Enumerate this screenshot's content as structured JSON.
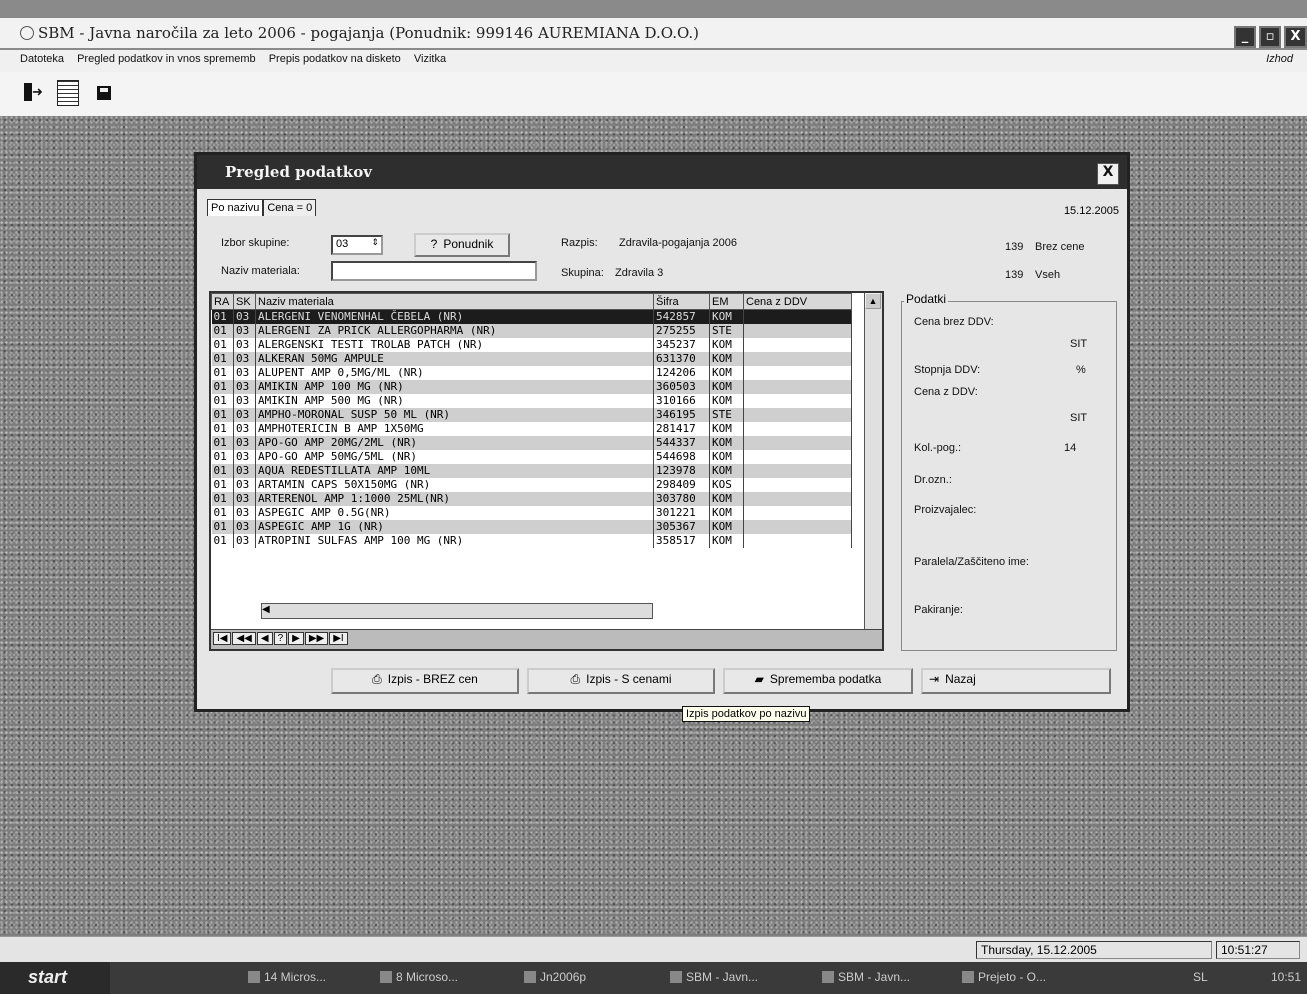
{
  "app": {
    "title": "SBM - Javna naročila za leto 2006 - pogajanja (Ponudnik: 999146 AUREMIANA D.O.O.)",
    "window_controls": [
      "_",
      "▫",
      "X"
    ]
  },
  "menu": {
    "items": [
      "Datoteka",
      "Pregled podatkov in vnos sprememb",
      "Prepis podatkov na disketo",
      "Vizitka"
    ],
    "exit_label": "Izhod"
  },
  "toolbar": {
    "icons": [
      "exit-door-icon",
      "document-icon",
      "floppy-icon"
    ]
  },
  "dialog": {
    "title": "Pregled podatkov",
    "close_label": "X",
    "tabs": [
      "Po nazivu",
      "Cena = 0"
    ],
    "date": "15.12.2005",
    "izbor_label": "Izbor skupine:",
    "izbor_value": "03",
    "ponudnik_button": "Ponudnik",
    "naziv_label": "Naziv materiala:",
    "naziv_value": "",
    "razpis_label": "Razpis:",
    "razpis_value": "Zdravila-pogajanja 2006",
    "skupina_label": "Skupina:",
    "skupina_value": "Zdravila 3",
    "count_brez_value": "139",
    "count_brez_label": "Brez cene",
    "count_vseh_value": "139",
    "count_vseh_label": "Vseh"
  },
  "grid": {
    "columns": [
      "RA",
      "SK",
      "Naziv materiala",
      "Šifra",
      "EM",
      "Cena z DDV"
    ],
    "rows": [
      [
        "01",
        "03",
        "ALERGENI VENOMENHAL ČEBELA (NR)",
        "542857",
        "KOM",
        ""
      ],
      [
        "01",
        "03",
        "ALERGENI ZA PRICK ALLERGOPHARMA (NR)",
        "275255",
        "STE",
        ""
      ],
      [
        "01",
        "03",
        "ALERGENSKI TESTI TROLAB PATCH (NR)",
        "345237",
        "KOM",
        ""
      ],
      [
        "01",
        "03",
        "ALKERAN 50MG AMPULE",
        "631370",
        "KOM",
        ""
      ],
      [
        "01",
        "03",
        "ALUPENT AMP 0,5MG/ML (NR)",
        "124206",
        "KOM",
        ""
      ],
      [
        "01",
        "03",
        "AMIKIN AMP 100 MG (NR)",
        "360503",
        "KOM",
        ""
      ],
      [
        "01",
        "03",
        "AMIKIN AMP 500 MG (NR)",
        "310166",
        "KOM",
        ""
      ],
      [
        "01",
        "03",
        "AMPHO-MORONAL SUSP 50 ML (NR)",
        "346195",
        "STE",
        ""
      ],
      [
        "01",
        "03",
        "AMPHOTERICIN B AMP 1X50MG",
        "281417",
        "KOM",
        ""
      ],
      [
        "01",
        "03",
        "APO-GO AMP 20MG/2ML (NR)",
        "544337",
        "KOM",
        ""
      ],
      [
        "01",
        "03",
        "APO-GO AMP 50MG/5ML (NR)",
        "544698",
        "KOM",
        ""
      ],
      [
        "01",
        "03",
        "AQUA REDESTILLATA AMP 10ML",
        "123978",
        "KOM",
        ""
      ],
      [
        "01",
        "03",
        "ARTAMIN CAPS 50X150MG (NR)",
        "298409",
        "KOS",
        ""
      ],
      [
        "01",
        "03",
        "ARTERENOL AMP 1:1000 25ML(NR)",
        "303780",
        "KOM",
        ""
      ],
      [
        "01",
        "03",
        "ASPEGIC AMP 0.5G(NR)",
        "301221",
        "KOM",
        ""
      ],
      [
        "01",
        "03",
        "ASPEGIC AMP 1G (NR)",
        "305367",
        "KOM",
        ""
      ],
      [
        "01",
        "03",
        "ATROPINI SULFAS AMP 100 MG (NR)",
        "358517",
        "KOM",
        ""
      ]
    ],
    "nav": [
      "I◀",
      "◀◀",
      "◀",
      "?",
      "▶",
      "▶▶",
      "▶I"
    ]
  },
  "info": {
    "header": "Podatki",
    "cena_brez_label": "Cena brez DDV:",
    "cena_brez_unit": "SIT",
    "stopnja_label": "Stopnja DDV:",
    "stopnja_unit": "%",
    "cena_z_label": "Cena z DDV:",
    "cena_z_unit": "SIT",
    "kol_label": "Kol.-pog.:",
    "kol_value": "14",
    "drozn_label": "Dr.ozn.:",
    "proizvajalec_label": "Proizvajalec:",
    "paralela_label": "Paralela/Zaščiteno ime:",
    "pakiranje_label": "Pakiranje:"
  },
  "buttons": {
    "izpis_brez": "Izpis - BREZ cen",
    "izpis_s": "Izpis - S cenami",
    "sprememba": "Sprememba podatka",
    "nazaj": "Nazaj"
  },
  "tooltip": "Izpis podatkov po nazivu",
  "statusbar": {
    "date": "Thursday, 15.12.2005",
    "time": "10:51:27"
  },
  "taskbar": {
    "start": "start",
    "tasks": [
      "14 Micros...",
      "8 Microso...",
      "Jn2006p",
      "SBM - Javn...",
      "SBM - Javn...",
      "Prejeto - O..."
    ],
    "tray_lang": "SL",
    "tray_time": "10:51"
  }
}
